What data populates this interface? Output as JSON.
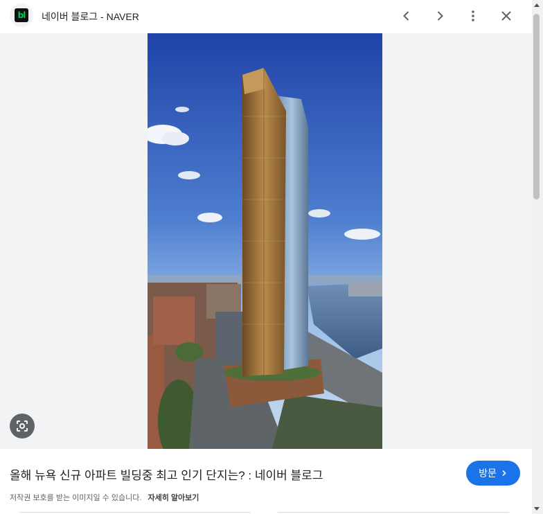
{
  "header": {
    "favicon_text": "bl",
    "site_title": "네이버 블로그 - NAVER",
    "icons": [
      "chevron-left-icon",
      "chevron-right-icon",
      "more-vert-icon",
      "close-icon"
    ]
  },
  "viewer": {
    "lens_icon": "google-lens-icon"
  },
  "info": {
    "caption": "올해 뉴욕 신규 아파트 빌딩중 최고 인기 단지는? : 네이버 블로그",
    "visit_label": "방문",
    "copyright_text": "저작권 보호를 받는 이미지일 수 있습니다.",
    "learn_more": "자세히 알아보기"
  },
  "colors": {
    "accent": "#1a73e8",
    "brand_green": "#03c75a"
  }
}
